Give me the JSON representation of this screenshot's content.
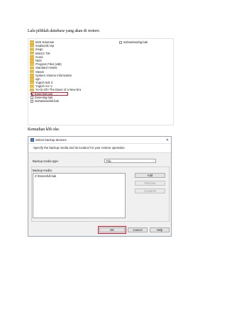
{
  "intro": {
    "prefix": "Lalu pilihlah ",
    "italic": "database",
    "middle": " yang akan di ",
    "italic2": "restore",
    "suffix": "."
  },
  "file_browser": {
    "left_items": [
      {
        "name": "MJK Edumam",
        "icon": "folder-icon"
      },
      {
        "name": "madworld.nsp",
        "icon": "folder-icon"
      },
      {
        "name": "mego",
        "icon": "folder-icon"
      },
      {
        "name": "MSGO TW",
        "icon": "folder-icon"
      },
      {
        "name": "music",
        "icon": "folder-icon"
      },
      {
        "name": "NDS",
        "icon": "folder-icon"
      },
      {
        "name": "Program Files (x86)",
        "icon": "folder-icon"
      },
      {
        "name": "Standard Assets",
        "icon": "folder-icon"
      },
      {
        "name": "Steam",
        "icon": "folder-icon"
      },
      {
        "name": "System Volume Information",
        "icon": "folder-icon"
      },
      {
        "name": "xgn",
        "icon": "folder-icon"
      },
      {
        "name": "Yugioh 5ds 3",
        "icon": "folder-icon"
      },
      {
        "name": "Yugioh Arc V",
        "icon": "folder-icon"
      },
      {
        "name": "Yu-Gi-Oh! The Dawn of a New Era",
        "icon": "folder-icon"
      },
      {
        "name": "Dosenfull.bak",
        "icon": "file-icon",
        "selected": true
      },
      {
        "name": "Dosenlog.bak",
        "icon": "file-icon"
      },
      {
        "name": "mahasiswafull.bak",
        "icon": "file-icon"
      }
    ],
    "right_items": [
      {
        "name": "mahasiswalog.bak",
        "icon": "file-icon"
      }
    ]
  },
  "second_para": {
    "prefix": "Kemudian ",
    "italic": "klik",
    "suffix": " oke."
  },
  "dialog": {
    "title": "Select backup devices",
    "close_glyph": "✕",
    "banner": "Specify the backup media and its location for your restore operation.",
    "media_type_label": "Backup media type:",
    "media_type_value": "File",
    "media_label": "Backup media:",
    "media_items": [
      "Z:\\Dosenfull.bak"
    ],
    "buttons": {
      "add": "Add",
      "remove": "Remove",
      "contents": "Contents",
      "ok": "OK",
      "cancel": "Cancel",
      "help": "Help"
    },
    "highlight_color": "#d6142b"
  }
}
